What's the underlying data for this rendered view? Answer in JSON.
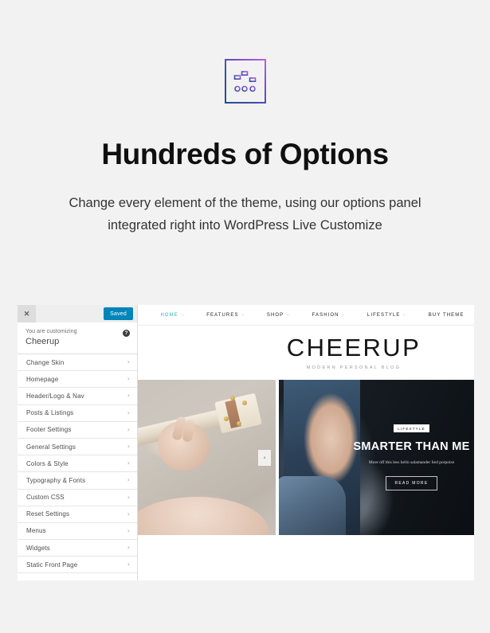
{
  "hero": {
    "icon_name": "sliders-options-icon",
    "title": "Hundreds of Options",
    "subtitle_line1": "Change every element of the theme, using our options panel",
    "subtitle_line2": "integrated right into WordPress Live Customize",
    "icon_gradient_start": "#1f4e9c",
    "icon_gradient_end": "#c060e8"
  },
  "customizer": {
    "close_label": "✕",
    "saved_label": "Saved",
    "saved_color": "#0085ba",
    "help_label": "?",
    "customizing_label": "You are customizing",
    "site_title": "Cheerup",
    "chevron": "›",
    "items": [
      {
        "label": "Change Skin"
      },
      {
        "label": "Homepage"
      },
      {
        "label": "Header/Logo & Nav"
      },
      {
        "label": "Posts & Listings"
      },
      {
        "label": "Footer Settings"
      },
      {
        "label": "General Settings"
      },
      {
        "label": "Colors & Style"
      },
      {
        "label": "Typography & Fonts"
      },
      {
        "label": "Custom CSS"
      },
      {
        "label": "Reset Settings"
      },
      {
        "label": "Menus"
      },
      {
        "label": "Widgets"
      },
      {
        "label": "Static Front Page"
      }
    ]
  },
  "preview": {
    "nav": [
      {
        "label": "HOME",
        "has_caret": true,
        "active": true
      },
      {
        "label": "FEATURES",
        "has_caret": true,
        "active": false
      },
      {
        "label": "SHOP",
        "has_caret": true,
        "active": false
      },
      {
        "label": "FASHION",
        "has_caret": true,
        "active": false
      },
      {
        "label": "LIFESTYLE",
        "has_caret": true,
        "active": false
      },
      {
        "label": "BUY THEME",
        "has_caret": false,
        "active": false
      }
    ],
    "active_nav_color": "#31b3c4",
    "caret": "⌄",
    "brand": {
      "logo": "CHEERUP",
      "tagline": "MODERN PERSONAL BLOG"
    },
    "cards": {
      "left": {
        "image_alt": "hands-holding-ukulele-photo",
        "prev_arrow": "‹"
      },
      "right": {
        "badge": "LIFESTYLE",
        "headline": "SMARTER THAN ME",
        "excerpt": "More off this less hello salamander lied porpoise",
        "read_more": "READ MORE"
      }
    }
  }
}
